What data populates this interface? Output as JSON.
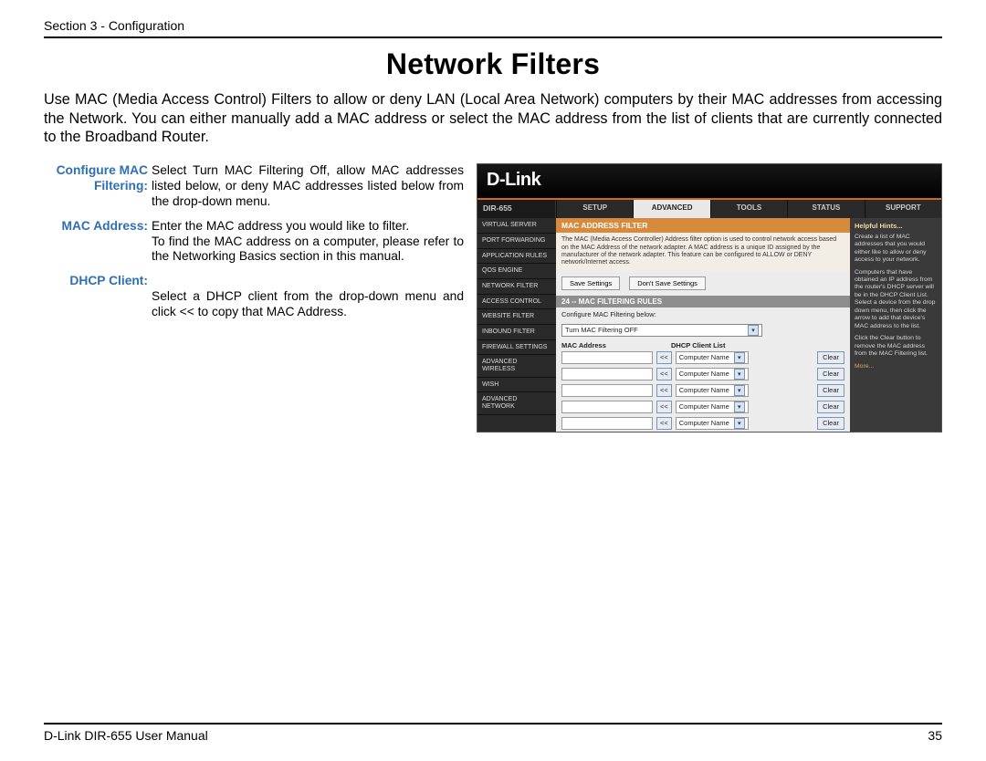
{
  "header": {
    "section": "Section 3 - Configuration"
  },
  "title": "Network Filters",
  "intro": "Use MAC (Media Access Control) Filters to allow or deny LAN (Local Area Network) computers by their MAC addresses from accessing the Network. You can either manually add a MAC address or select the MAC address from the list of clients that are currently connected to the Broadband Router.",
  "defs": [
    {
      "term": "Configure MAC Filtering:",
      "text": "Select Turn MAC Filtering Off, allow MAC addresses listed below, or deny MAC addresses listed below from the drop-down menu."
    },
    {
      "term": "MAC Address:",
      "text": "Enter the MAC address you would like to filter.\nTo find the MAC address on a computer, please refer to the Networking Basics section in this manual."
    },
    {
      "term": "DHCP Client:",
      "text": "\nSelect a DHCP client from the drop-down menu and click << to copy that MAC Address."
    }
  ],
  "shot": {
    "brand": "D-Link",
    "model": "DIR-655",
    "tabs": [
      "SETUP",
      "ADVANCED",
      "TOOLS",
      "STATUS",
      "SUPPORT"
    ],
    "activeTab": 1,
    "sidebar": [
      "VIRTUAL SERVER",
      "PORT FORWARDING",
      "APPLICATION RULES",
      "QOS ENGINE",
      "NETWORK FILTER",
      "ACCESS CONTROL",
      "WEBSITE FILTER",
      "INBOUND FILTER",
      "FIREWALL SETTINGS",
      "ADVANCED WIRELESS",
      "WISH",
      "ADVANCED NETWORK"
    ],
    "panelTitle": "MAC ADDRESS FILTER",
    "panelHelp": "The MAC (Media Access Controller) Address filter option is used to control network access based on the MAC Address of the network adapter. A MAC address is a unique ID assigned by the manufacturer of the network adapter. This feature can be configured to ALLOW or DENY network/Internet access.",
    "saveBtn": "Save Settings",
    "dontSaveBtn": "Don't Save Settings",
    "rulesTitle": "24 -- MAC FILTERING RULES",
    "cfgLabel": "Configure MAC Filtering below:",
    "ddValue": "Turn MAC Filtering OFF",
    "colA": "MAC Address",
    "colB": "DHCP Client List",
    "cnLabel": "Computer Name",
    "copyLabel": "<<",
    "clearLabel": "Clear",
    "hintsTitle": "Helpful Hints...",
    "hints1": "Create a list of MAC addresses that you would either like to allow or deny access to your network.",
    "hints2": "Computers that have obtained an IP address from the router's DHCP server will be in the DHCP Client List. Select a device from the drop down menu, then click the arrow to add that device's MAC address to the list.",
    "hints3": "Click the Clear button to remove the MAC address from the MAC Filtering list.",
    "more": "More..."
  },
  "footer": {
    "left": "D-Link DIR-655 User Manual",
    "right": "35"
  }
}
